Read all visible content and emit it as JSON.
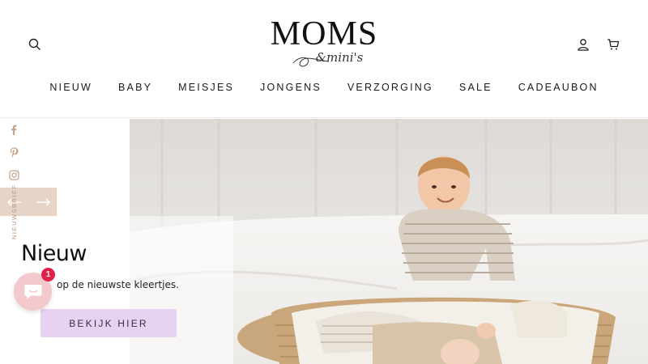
{
  "brand": {
    "name": "MOMS",
    "sub": "&mini's"
  },
  "header": {
    "search_icon": "search-icon",
    "account_icon": "user-icon",
    "cart_icon": "cart-icon"
  },
  "nav": {
    "items": [
      {
        "label": "NIEUW"
      },
      {
        "label": "BABY"
      },
      {
        "label": "MEISJES"
      },
      {
        "label": "JONGENS"
      },
      {
        "label": "VERZORGING"
      },
      {
        "label": "SALE"
      },
      {
        "label": "CADEAUBON"
      }
    ]
  },
  "social": {
    "icons": [
      "facebook-icon",
      "pinterest-icon",
      "instagram-icon"
    ]
  },
  "slider": {
    "vertical_label": "NIEUWSBRIEF",
    "prev_icon": "arrow-left-icon",
    "next_icon": "arrow-right-icon"
  },
  "hero": {
    "title": "Nieuw",
    "subtitle": "op de nieuwste kleertjes.",
    "cta_label": "BEKIJK HIER"
  },
  "chat": {
    "badge_count": "1"
  },
  "colors": {
    "cta_bg": "#e7d2ef",
    "arrow_bg": "#e6d5c6",
    "badge": "#e0224a",
    "chat_bg": "#f3c9cd"
  }
}
